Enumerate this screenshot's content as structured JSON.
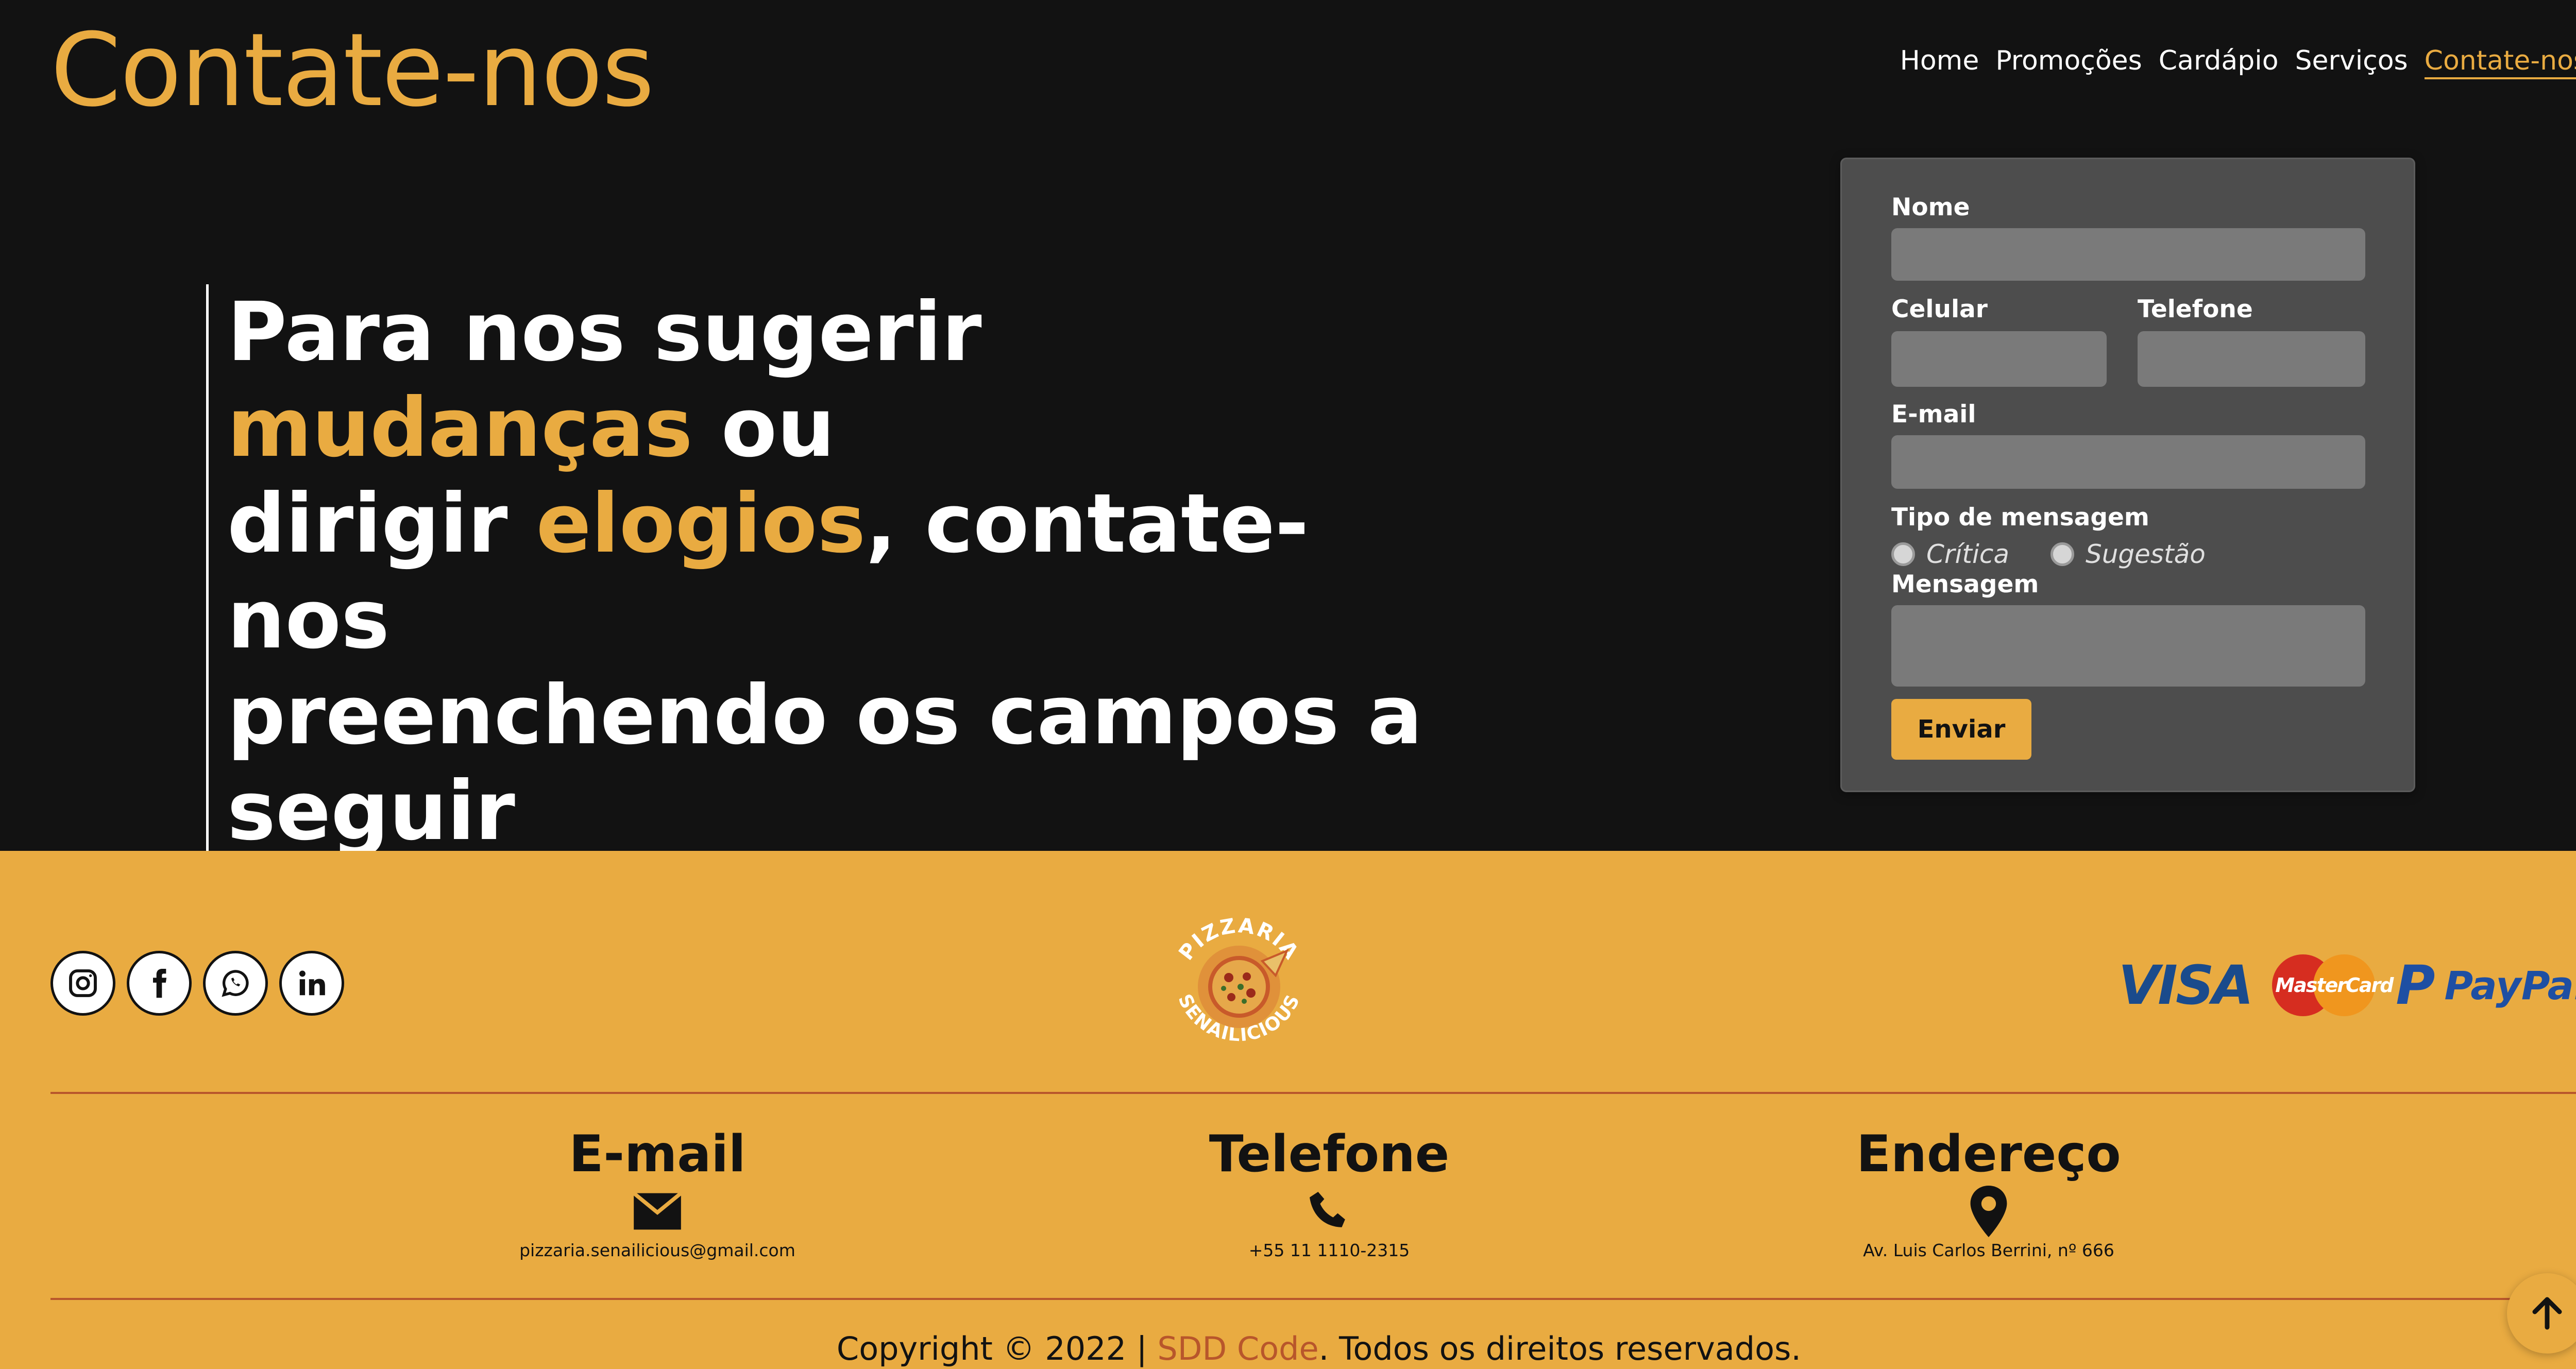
{
  "header": {
    "title": "Contate-nos",
    "nav": [
      {
        "label": "Home"
      },
      {
        "label": "Promoções"
      },
      {
        "label": "Cardápio"
      },
      {
        "label": "Serviços"
      },
      {
        "label": "Contate-nos",
        "active": true
      }
    ]
  },
  "hero": {
    "line1_a": "Para nos sugerir ",
    "line1_hl": "mudanças",
    "line1_b": " ou",
    "line2_a": "dirigir ",
    "line2_hl": "elogios",
    "line2_b": ", contate-nos",
    "line3": "preenchendo os campos a",
    "line4": "seguir"
  },
  "form": {
    "name_label": "Nome",
    "name_value": "",
    "cell_label": "Celular",
    "cell_value": "",
    "phone_label": "Telefone",
    "phone_value": "",
    "email_label": "E-mail",
    "email_value": "",
    "type_label": "Tipo de mensagem",
    "type_options": [
      {
        "label": "Crítica",
        "selected": false
      },
      {
        "label": "Sugestão",
        "selected": false
      }
    ],
    "message_label": "Mensagem",
    "message_value": "",
    "submit_label": "Enviar"
  },
  "footer": {
    "social_icons": [
      "instagram-icon",
      "facebook-icon",
      "whatsapp-icon",
      "linkedin-icon"
    ],
    "logo_top_text": "PIZZARIA",
    "logo_bottom_text": "SENAILICIOUS",
    "payments": {
      "visa": "VISA",
      "mastercard": "MasterCard",
      "paypal_mark": "P",
      "paypal": "PayPal"
    },
    "contacts": [
      {
        "title": "E-mail",
        "icon": "envelope-icon",
        "value": "pizzaria.senailicious@gmail.com"
      },
      {
        "title": "Telefone",
        "icon": "phone-icon",
        "value": "+55 11 1110-2315"
      },
      {
        "title": "Endereço",
        "icon": "map-pin-icon",
        "value": "Av. Luis Carlos Berrini, nº 666"
      }
    ],
    "copyright_prefix": "Copyright © 2022 | ",
    "copyright_brand": "SDD Code",
    "copyright_suffix": ". Todos os direitos reservados."
  },
  "colors": {
    "accent": "#e9ab41",
    "background": "#121212",
    "form_bg": "#4d4d4d",
    "input_bg": "#7a7a7a",
    "brand_link": "#b8562b"
  }
}
